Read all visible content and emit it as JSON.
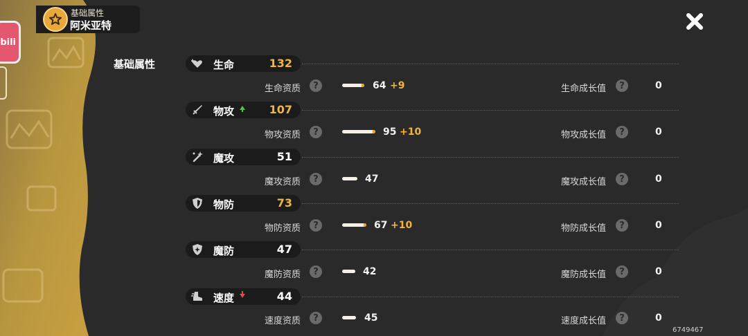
{
  "header": {
    "subtitle": "基础属性",
    "title": "阿米亚特",
    "badge_icon": "star-icon"
  },
  "side": {
    "bili_label": "bili"
  },
  "section": {
    "title": "基础属性"
  },
  "stats": [
    {
      "key": "hp",
      "name": "生命",
      "value": "132",
      "value_color": "#f2b63c",
      "icon": "heart-sparkle-icon",
      "trend": ""
    },
    {
      "key": "atk",
      "name": "物攻",
      "value": "107",
      "value_color": "#f2b63c",
      "icon": "sword-icon",
      "trend": "up"
    },
    {
      "key": "matk",
      "name": "魔攻",
      "value": "51",
      "value_color": "#ffffff",
      "icon": "wand-icon",
      "trend": ""
    },
    {
      "key": "def",
      "name": "物防",
      "value": "73",
      "value_color": "#f2b63c",
      "icon": "shield-icon",
      "trend": ""
    },
    {
      "key": "mdef",
      "name": "魔防",
      "value": "47",
      "value_color": "#ffffff",
      "icon": "magic-shield-icon",
      "trend": ""
    },
    {
      "key": "spd",
      "name": "速度",
      "value": "44",
      "value_color": "#ffffff",
      "icon": "boot-icon",
      "trend": "down"
    }
  ],
  "details": [
    {
      "aptitude_label": "生命资质",
      "aptitude": "64",
      "bonus": "+9",
      "bar_fill": 0.64,
      "growth_label": "生命成长值",
      "growth": "0"
    },
    {
      "aptitude_label": "物攻资质",
      "aptitude": "95",
      "bonus": "+10",
      "bar_fill": 0.95,
      "growth_label": "物攻成长值",
      "growth": "0"
    },
    {
      "aptitude_label": "魔攻资质",
      "aptitude": "47",
      "bonus": "",
      "bar_fill": 0.47,
      "growth_label": "魔攻成长值",
      "growth": "0"
    },
    {
      "aptitude_label": "物防资质",
      "aptitude": "67",
      "bonus": "+10",
      "bar_fill": 0.67,
      "growth_label": "物防成长值",
      "growth": "0"
    },
    {
      "aptitude_label": "魔防资质",
      "aptitude": "42",
      "bonus": "",
      "bar_fill": 0.42,
      "growth_label": "魔防成长值",
      "growth": "0"
    },
    {
      "aptitude_label": "速度资质",
      "aptitude": "45",
      "bonus": "",
      "bar_fill": 0.45,
      "growth_label": "速度成长值",
      "growth": "0"
    }
  ],
  "help_glyph": "?",
  "close_icon": "close-icon",
  "uid": "6749467",
  "colors": {
    "accent": "#f2b63c",
    "background": "#2a2a2b",
    "pill": "#1b1b1c",
    "gold": "#c9a24a"
  }
}
